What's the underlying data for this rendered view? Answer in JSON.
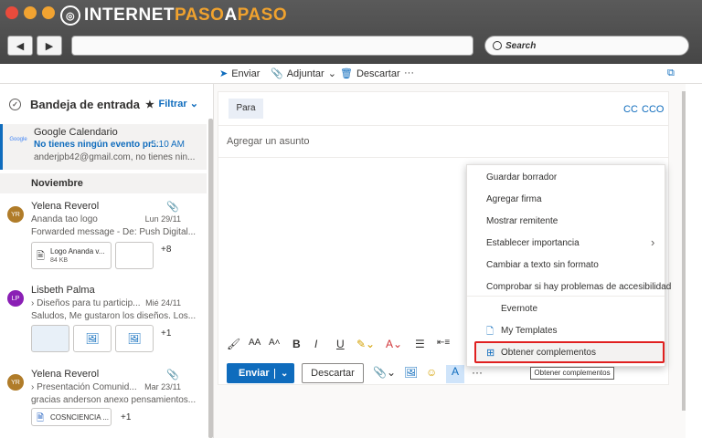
{
  "browser": {
    "logo_prefix": "INTERNET",
    "logo_highlight": "PASO",
    "logo_a": "A",
    "logo_suffix": "PASO",
    "search_placeholder": "Search"
  },
  "toolbar": {
    "send": "Enviar",
    "attach": "Adjuntar",
    "discard": "Descartar",
    "more": "···"
  },
  "inbox": {
    "title": "Bandeja de entrada",
    "filter": "Filtrar",
    "items": [
      {
        "sender": "Google Calendario",
        "subject": "No tienes ningún evento pr...",
        "time": "5:10 AM",
        "preview": "anderjpb42@gmail.com, no tienes nin...",
        "avatar": "Google"
      },
      {
        "sender": "Yelena Reverol",
        "subject": "Ananda tao logo",
        "time": "Lun 29/11",
        "preview": "Forwarded message - De: Push Digital...",
        "avatar": "YR",
        "attachment": "Logo Ananda v...",
        "attachment_size": "84 KB",
        "more": "+8"
      },
      {
        "sender": "Lisbeth Palma",
        "subject": "Diseños para tu particip...",
        "time": "Mié 24/11",
        "preview": "Saludos, Me gustaron los diseños. Los...",
        "avatar": "LP",
        "more": "+1"
      },
      {
        "sender": "Yelena Reverol",
        "subject": "Presentación Comunid...",
        "time": "Mar 23/11",
        "preview": "gracias anderson anexo pensamientos...",
        "avatar": "YR",
        "attachment": "COSNCIENCIA ...",
        "more": "+1"
      }
    ],
    "section": "Noviembre"
  },
  "compose": {
    "to": "Para",
    "cc": "CC",
    "bcc": "CCO",
    "subject_placeholder": "Agregar un asunto",
    "send": "Enviar",
    "discard": "Descartar"
  },
  "menu": {
    "items": [
      "Guardar borrador",
      "Agregar firma",
      "Mostrar remitente",
      "Establecer importancia",
      "Cambiar a texto sin formato",
      "Comprobar si hay problemas de accesibilidad",
      "Evernote",
      "My Templates",
      "Obtener complementos"
    ]
  },
  "tooltip": "Obtener complementos",
  "colors": {
    "accent": "#0f6cbd",
    "highlight_border": "#e02020"
  }
}
